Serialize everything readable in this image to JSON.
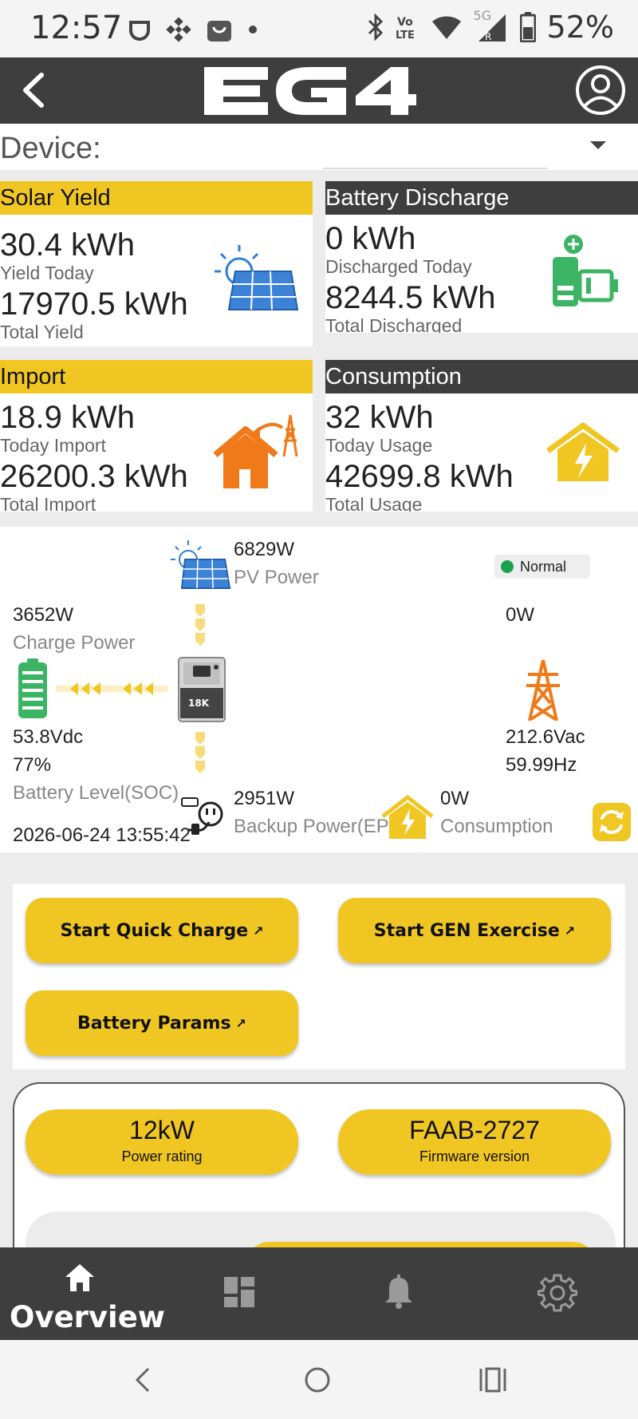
{
  "status_bar": {
    "time": "12:57",
    "battery_percent": "52%",
    "network": "5G",
    "icons": [
      "hotspot-icon",
      "binance-icon",
      "shopping-bag-icon",
      "dot-icon",
      "bluetooth-icon",
      "volte-icon",
      "wifi-icon",
      "signal-icon",
      "battery-icon"
    ]
  },
  "header": {
    "logo_text": "EG4",
    "icons": [
      "back-arrow-icon",
      "account-icon"
    ]
  },
  "device": {
    "label": "Device:",
    "value": ""
  },
  "cards": {
    "solar": {
      "title": "Solar Yield",
      "today_value": "30.4 kWh",
      "today_label": "Yield Today",
      "total_value": "17970.5 kWh",
      "total_label": "Total Yield",
      "icon": "solar-panel-icon"
    },
    "battery": {
      "title": "Battery Discharge",
      "today_value": "0 kWh",
      "today_label": "Discharged Today",
      "total_value": "8244.5 kWh",
      "total_label": "Total Discharged",
      "icon": "battery-charge-icon"
    },
    "import": {
      "title": "Import",
      "today_value": "18.9 kWh",
      "today_label": "Today Import",
      "total_value": "26200.3 kWh",
      "total_label": "Total Import",
      "icon": "home-grid-icon"
    },
    "consumption": {
      "title": "Consumption",
      "today_value": "32 kWh",
      "today_label": "Today Usage",
      "total_value": "42699.8 kWh",
      "total_label": "Total Usage",
      "icon": "home-lightning-icon"
    }
  },
  "flow": {
    "pv_power_value": "6829W",
    "pv_power_label": "PV Power",
    "status": "Normal",
    "charge_power_value": "3652W",
    "charge_power_label": "Charge Power",
    "grid_power_value": "0W",
    "battery_voltage": "53.8Vdc",
    "battery_soc": "77%",
    "battery_soc_label": "Battery Level(SOC)",
    "grid_voltage": "212.6Vac",
    "grid_frequency": "59.99Hz",
    "backup_power_value": "2951W",
    "backup_power_label": "Backup Power(EPS)",
    "consumption_value": "0W",
    "consumption_label": "Consumption",
    "timestamp": "2026-06-24 13:55:42",
    "inverter_label": "18K",
    "colors": {
      "flow_arrow": "#f0c623",
      "grid_tower": "#f07a1a",
      "battery": "#3bb563",
      "status_ok": "#1aa34a"
    }
  },
  "actions": {
    "quick_charge": "Start Quick Charge",
    "gen_exercise": "Start GEN Exercise",
    "battery_params": "Battery Params",
    "link_glyph": "↗"
  },
  "info": {
    "power_rating_value": "12kW",
    "power_rating_label": "Power rating",
    "firmware_value": "FAAB-2727",
    "firmware_label": "Firmware version"
  },
  "bottom_nav": {
    "items": [
      {
        "label": "Overview",
        "icon": "home-icon",
        "active": true
      },
      {
        "label": "",
        "icon": "dashboard-icon",
        "active": false
      },
      {
        "label": "",
        "icon": "bell-icon",
        "active": false
      },
      {
        "label": "",
        "icon": "gear-icon",
        "active": false
      }
    ]
  },
  "system_nav": {
    "icons": [
      "system-back-icon",
      "system-home-icon",
      "system-recents-icon"
    ]
  },
  "theme": {
    "accent": "#f0c623",
    "dark": "#3e3e3e",
    "background": "#ececec"
  }
}
